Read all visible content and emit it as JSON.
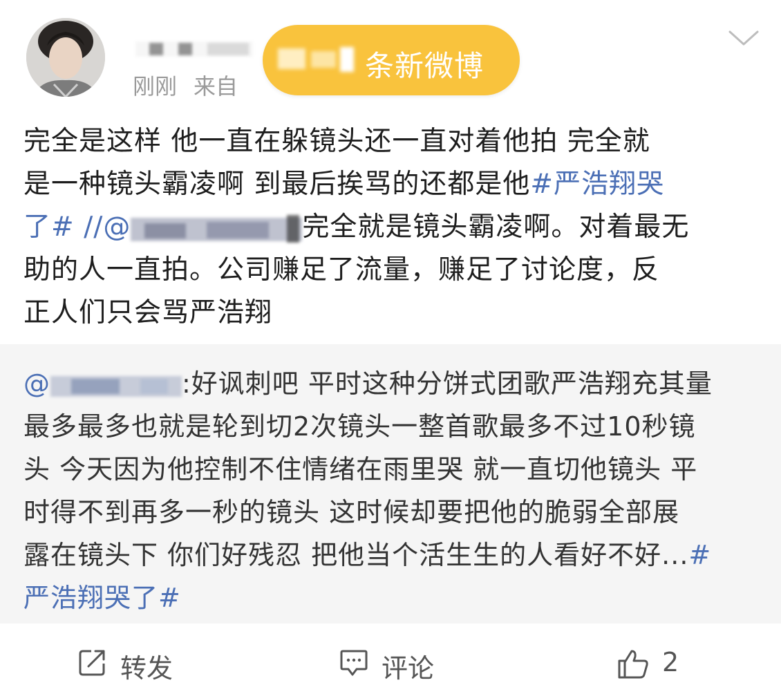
{
  "post": {
    "meta": {
      "time": "刚刚",
      "source_prefix": "来自"
    },
    "new_posts_banner": {
      "label": "条新微博"
    },
    "content": {
      "line1": "完全是这样 他一直在躲镜头还一直对着他拍 完全就",
      "line2_a": "是一种镜头霸凌啊 到最后挨骂的还都是他",
      "line2_hashtag": "#严浩翔哭",
      "line3_hashtag": "了#",
      "line3_mention": " //@",
      "line3_b": "完全就是镜头霸凌啊。对着最无",
      "line4": "助的人一直拍。公司赚足了流量，赚足了讨论度，反",
      "line5": "正人们只会骂严浩翔"
    },
    "retweet": {
      "mention_prefix": "@",
      "line1": ":好讽刺吧 平时这种分饼式团歌严浩翔充其量",
      "line2": "最多最多也就是轮到切2次镜头一整首歌最多不过10秒镜",
      "line3": "头 今天因为他控制不住情绪在雨里哭 就一直切他镜头 平",
      "line4": "时得不到再多一秒的镜头 这时候却要把他的脆弱全部展",
      "line5_a": "露在镜头下 你们好残忍 把他当个活生生的人看好不好...",
      "line5_hashtag": "#",
      "line6_hashtag": "严浩翔哭了#"
    },
    "actions": {
      "repost_label": "转发",
      "comment_label": "评论",
      "like_count": "2"
    },
    "icons": {
      "repost": "share-icon",
      "comment": "comment-icon",
      "like": "thumbs-up-icon",
      "menu": "chevron-down-icon"
    },
    "colors": {
      "link": "#4b6fb5",
      "banner": "#f9c33d",
      "meta": "#9a9a9a",
      "retweet_bg": "#f5f5f5"
    }
  }
}
